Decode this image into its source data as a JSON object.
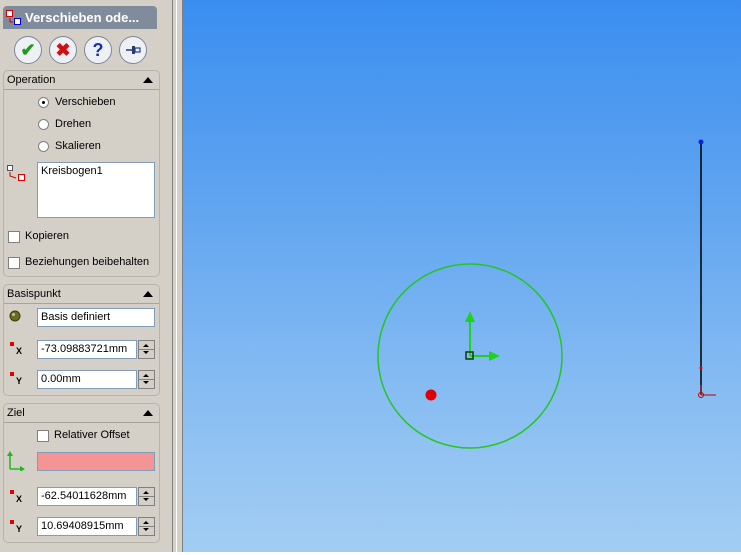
{
  "property_manager": {
    "title": "Verschieben ode...",
    "buttons": {
      "ok_icon": "checkmark-icon",
      "cancel_icon": "x-icon",
      "help_icon": "question-icon",
      "pin_icon": "pushpin-icon"
    },
    "operation": {
      "header": "Operation",
      "options": [
        "Verschieben",
        "Drehen",
        "Skalieren"
      ],
      "selected": "Verschieben",
      "selection_list": [
        "Kreisbogen1"
      ],
      "copy_label": "Kopieren",
      "keep_relations_label": "Beziehungen beibehalten"
    },
    "basepoint": {
      "header": "Basispunkt",
      "basis_value": "Basis definiert",
      "x_label": "X",
      "x_value": "-73.09883721mm",
      "y_label": "Y",
      "y_value": "0.00mm"
    },
    "target": {
      "header": "Ziel",
      "relative_offset_label": "Relativer Offset",
      "point_value": "",
      "x_label": "X",
      "x_value": "-62.54011628mm",
      "y_label": "Y",
      "y_value": "10.69408915mm"
    }
  },
  "colors": {
    "circle": "#22c722",
    "origin_arrows": "#1fd21f",
    "target_field": "#f49494",
    "point_marker": "#e00000",
    "line": "#000000",
    "endpoint": "#1020e0"
  }
}
